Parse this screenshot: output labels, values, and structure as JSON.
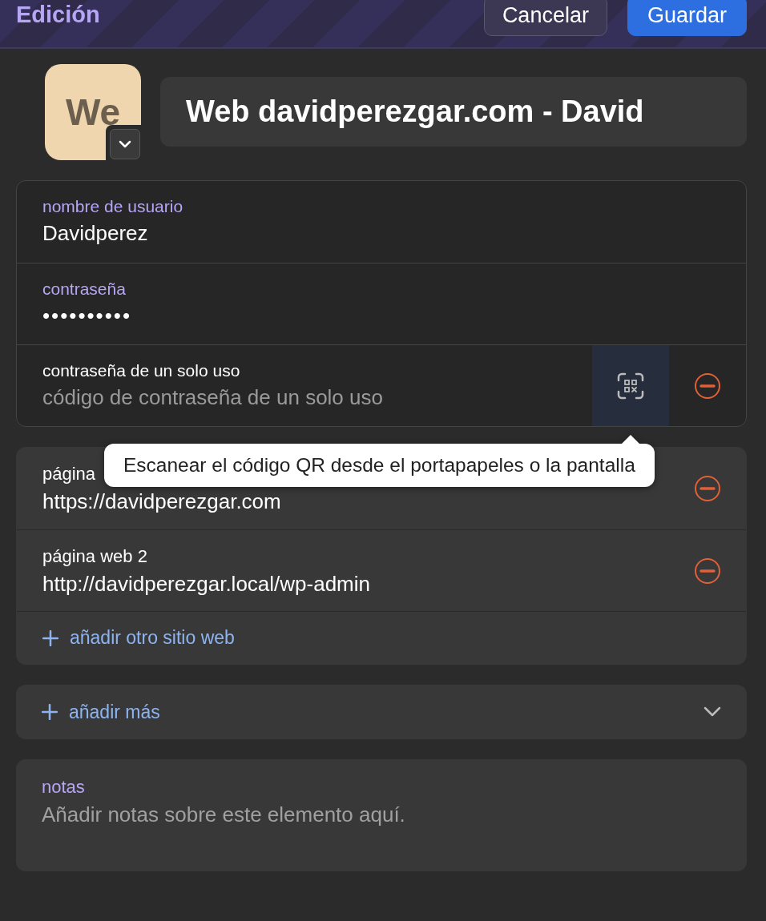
{
  "header": {
    "title": "Edición",
    "buttons": [
      {
        "label": "Cancelar",
        "kind": "secondary"
      },
      {
        "label": "Guardar",
        "kind": "primary"
      }
    ]
  },
  "item": {
    "icon_text": "We",
    "name": "Web davidperezgar.com - David"
  },
  "login_fields": [
    {
      "kind": "text",
      "label": "nombre de usuario",
      "value": "Davidperez"
    },
    {
      "kind": "password",
      "label": "contraseña",
      "value": "••••••••••"
    },
    {
      "kind": "otp",
      "label": "contraseña de un solo uso",
      "placeholder": "código de contraseña de un solo uso",
      "scan_hovered": true,
      "removable": true
    }
  ],
  "tooltip": "Escanear el código QR desde el portapapeles o la pantalla",
  "websites": [
    {
      "label": "página",
      "value": "https://davidperezgar.com",
      "removable": true
    },
    {
      "label": "página web 2",
      "value": "http://davidperezgar.local/wp-admin",
      "removable": true
    }
  ],
  "add_website": "añadir otro sitio web",
  "add_more": {
    "label": "añadir más",
    "expanded": false
  },
  "notes": {
    "label": "notas",
    "placeholder": "Añadir notas sobre este elemento aquí."
  }
}
